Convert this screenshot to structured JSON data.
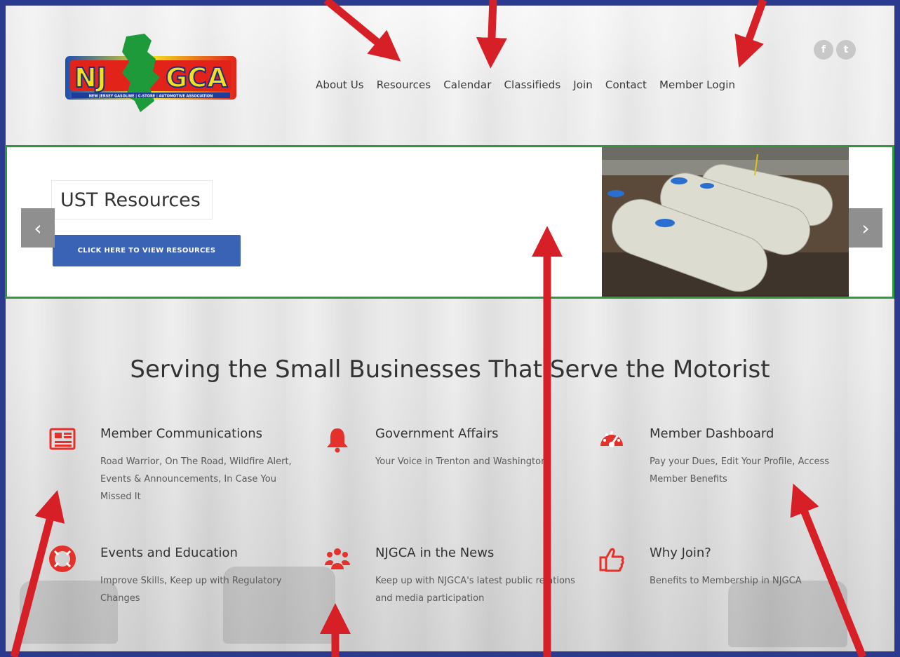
{
  "header": {
    "logo_text": "NJGCA",
    "logo_subtext": "NEW JERSEY GASOLINE | C-STORE | AUTOMOTIVE ASSOCIATION",
    "nav": [
      "About Us",
      "Resources",
      "Calendar",
      "Classifieds",
      "Join",
      "Contact",
      "Member Login"
    ],
    "social": [
      {
        "icon": "facebook-icon",
        "glyph": "f"
      },
      {
        "icon": "twitter-icon",
        "glyph": "t"
      }
    ]
  },
  "slider": {
    "title": "UST Resources",
    "button_label": "CLICK HERE TO VIEW RESOURCES",
    "prev_glyph": "‹",
    "next_glyph": "›",
    "image": "underground-storage-tanks"
  },
  "tagline": "Serving the Small Businesses That Serve the Motorist",
  "features": [
    {
      "icon": "newspaper-icon",
      "title": "Member Communications",
      "desc": "Road Warrior, On The Road, Wildfire Alert, Events & Announcements, In Case You Missed It"
    },
    {
      "icon": "bell-icon",
      "title": "Government Affairs",
      "desc": "Your Voice in Trenton and Washington"
    },
    {
      "icon": "dashboard-icon",
      "title": "Member Dashboard",
      "desc": "Pay your Dues, Edit Your Profile, Access Member Benefits"
    },
    {
      "icon": "life-ring-icon",
      "title": "Events and Education",
      "desc": "Improve Skills, Keep up with Regulatory Changes"
    },
    {
      "icon": "users-icon",
      "title": "NJGCA in the News",
      "desc": "Keep up with NJGCA's latest public relations and media participation"
    },
    {
      "icon": "thumbs-up-icon",
      "title": "Why Join?",
      "desc": "Benefits to Membership in NJGCA"
    }
  ],
  "colors": {
    "frame": "#2b3a8f",
    "slider_border": "#2d9b3c",
    "button": "#3a62b5",
    "icon_red": "#e4312b",
    "annotation_arrow": "#d61f26"
  }
}
